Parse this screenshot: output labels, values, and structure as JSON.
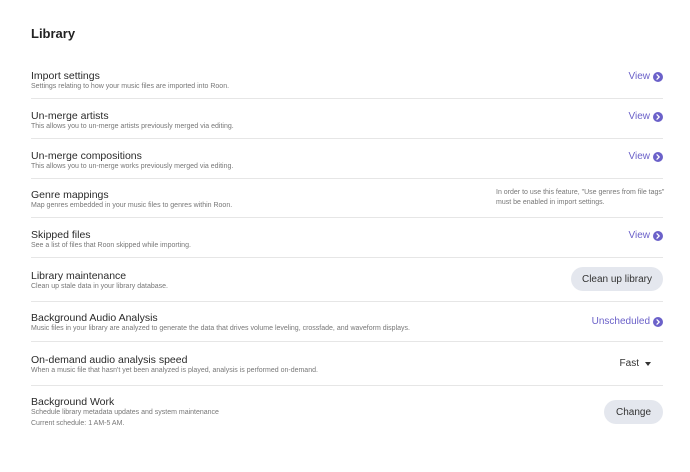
{
  "page": {
    "title": "Library"
  },
  "rows": {
    "import_settings": {
      "title": "Import settings",
      "desc": "Settings relating to how your music files are imported into Roon.",
      "action": "View"
    },
    "unmerge_artists": {
      "title": "Un-merge artists",
      "desc": "This allows you to un-merge artists previously merged via editing.",
      "action": "View"
    },
    "unmerge_compositions": {
      "title": "Un-merge compositions",
      "desc": "This allows you to un-merge works previously merged via editing.",
      "action": "View"
    },
    "genre_mappings": {
      "title": "Genre mappings",
      "desc": "Map genres embedded in your music files to genres within Roon.",
      "note": "In order to use this feature, \"Use genres from file tags\" must be enabled in import settings."
    },
    "skipped_files": {
      "title": "Skipped files",
      "desc": "See a list of files that Roon skipped while importing.",
      "action": "View"
    },
    "library_maintenance": {
      "title": "Library maintenance",
      "desc": "Clean up stale data in your library database.",
      "button": "Clean up library"
    },
    "background_audio_analysis": {
      "title": "Background Audio Analysis",
      "desc": "Music files in your library are analyzed to generate the data that drives volume leveling, crossfade, and waveform displays.",
      "action": "Unscheduled"
    },
    "ondemand_analysis_speed": {
      "title": "On-demand audio analysis speed",
      "desc": "When a music file that hasn't yet been analyzed is played, analysis is performed on-demand.",
      "selected": "Fast"
    },
    "background_work": {
      "title": "Background Work",
      "desc": "Schedule library metadata updates and system maintenance",
      "schedule": "Current schedule: 1 AM-5 AM.",
      "button": "Change"
    }
  },
  "colors": {
    "accent": "#6b61c9",
    "button_bg": "#e4e7ee",
    "divider": "#e6e6e6"
  }
}
